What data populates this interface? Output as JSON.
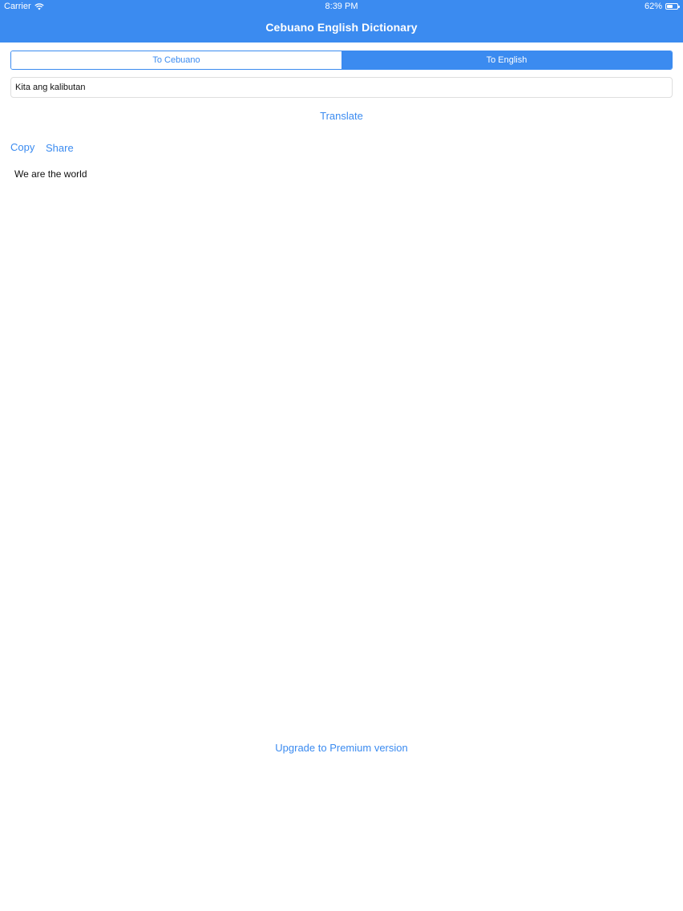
{
  "status_bar": {
    "carrier": "Carrier",
    "time": "8:39 PM",
    "battery_percent": "62%",
    "battery_level": 0.62,
    "wifi_icon": "wifi-icon",
    "battery_icon": "battery-icon"
  },
  "nav": {
    "title": "Cebuano English Dictionary"
  },
  "segments": [
    {
      "label": "To Cebuano",
      "selected": false
    },
    {
      "label": "To English",
      "selected": true
    }
  ],
  "input": {
    "value": "Kita ang kalibutan"
  },
  "actions": {
    "translate_label": "Translate",
    "copy_label": "Copy",
    "share_label": "Share"
  },
  "result": {
    "text": "We are the world"
  },
  "footer": {
    "upgrade_label": "Upgrade to Premium version"
  },
  "colors": {
    "accent": "#3b8bf0",
    "background": "#ffffff",
    "text": "#111111",
    "input_border": "#dedede"
  }
}
